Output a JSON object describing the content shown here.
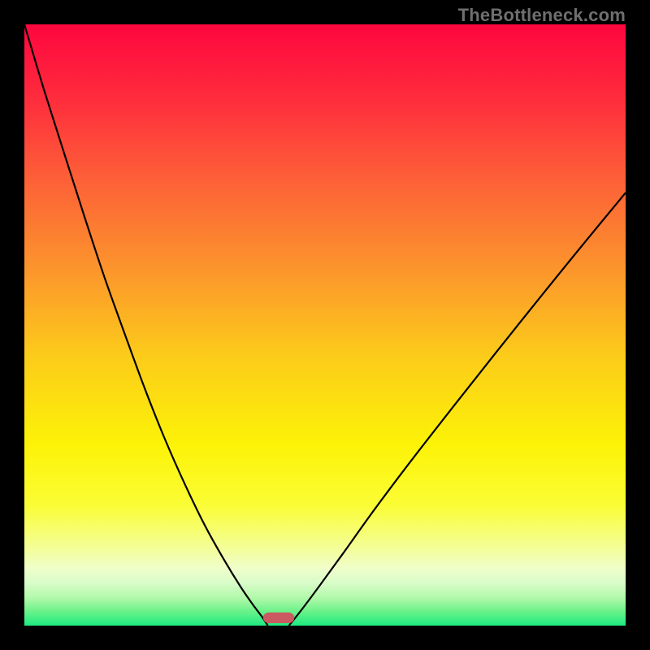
{
  "watermark": "TheBottleneck.com",
  "colors": {
    "frame": "#000000",
    "curve": "#000000",
    "marker_fill": "#cb5961",
    "gradient_stops": [
      {
        "offset": 0.0,
        "color": "#fe063e"
      },
      {
        "offset": 0.12,
        "color": "#fe2b3d"
      },
      {
        "offset": 0.25,
        "color": "#fd5d38"
      },
      {
        "offset": 0.4,
        "color": "#fc922d"
      },
      {
        "offset": 0.55,
        "color": "#fccb1a"
      },
      {
        "offset": 0.7,
        "color": "#fcf307"
      },
      {
        "offset": 0.8,
        "color": "#fbfd35"
      },
      {
        "offset": 0.875,
        "color": "#f3fe9d"
      },
      {
        "offset": 0.905,
        "color": "#effecb"
      },
      {
        "offset": 0.93,
        "color": "#d8fcc8"
      },
      {
        "offset": 0.955,
        "color": "#aef9a8"
      },
      {
        "offset": 0.975,
        "color": "#6ff28b"
      },
      {
        "offset": 1.0,
        "color": "#1deb81"
      }
    ]
  },
  "chart_data": {
    "type": "line",
    "title": "",
    "xlabel": "",
    "ylabel": "",
    "xlim": [
      0,
      100
    ],
    "ylim": [
      0,
      100
    ],
    "grid": false,
    "legend": false,
    "series": [
      {
        "name": "left-branch",
        "x": [
          0.0,
          3.3,
          6.7,
          10.0,
          13.3,
          16.7,
          20.0,
          23.3,
          26.7,
          30.0,
          33.3,
          36.0,
          38.0,
          39.5,
          40.5
        ],
        "y": [
          100.0,
          89.0,
          78.3,
          68.0,
          58.0,
          48.5,
          39.5,
          31.2,
          23.5,
          16.7,
          10.8,
          6.4,
          3.5,
          1.5,
          0.0
        ]
      },
      {
        "name": "right-branch",
        "x": [
          44.0,
          46.0,
          49.0,
          53.0,
          58.0,
          64.0,
          71.0,
          78.5,
          86.5,
          93.0,
          100.0
        ],
        "y": [
          0.0,
          2.5,
          6.5,
          12.0,
          19.0,
          27.0,
          36.0,
          45.5,
          55.5,
          63.5,
          72.0
        ]
      }
    ],
    "marker": {
      "name": "vertex-marker",
      "x_center": 42.3,
      "y_center": 1.3,
      "width": 5.2,
      "height": 1.8,
      "rx": 1.0
    }
  }
}
